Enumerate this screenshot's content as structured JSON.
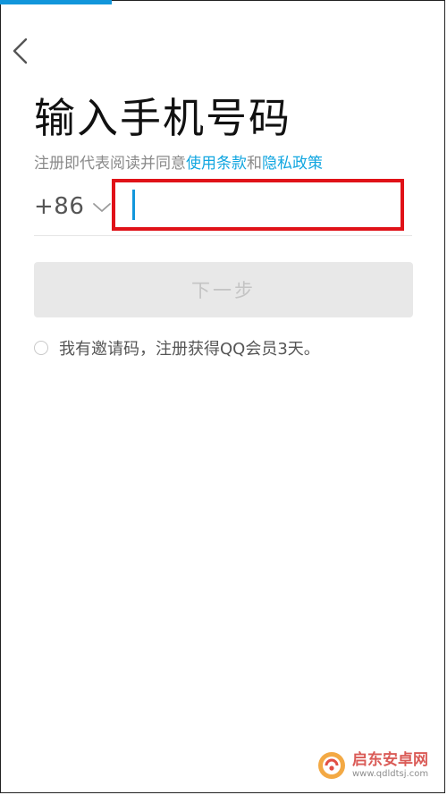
{
  "header": {
    "back_icon": "chevron-left-icon",
    "progress_fraction": 0.25
  },
  "page": {
    "title": "输入手机号码",
    "agreement_prefix": "注册即代表阅读并同意",
    "terms_link": "使用条款",
    "and_text": "和",
    "privacy_link": "隐私政策"
  },
  "phone": {
    "country_code": "+86",
    "dropdown_icon": "chevron-down-icon",
    "value": ""
  },
  "actions": {
    "next_label": "下一步"
  },
  "invite": {
    "text": "我有邀请码，注册获得QQ会员3天。",
    "checked": false
  },
  "watermark": {
    "title": "启东安卓网",
    "url": "www.qdldtsj.com"
  },
  "colors": {
    "accent": "#1296db",
    "link": "#12a6e0",
    "highlight_box": "#e01218",
    "button_disabled_bg": "#e8e8e8"
  }
}
